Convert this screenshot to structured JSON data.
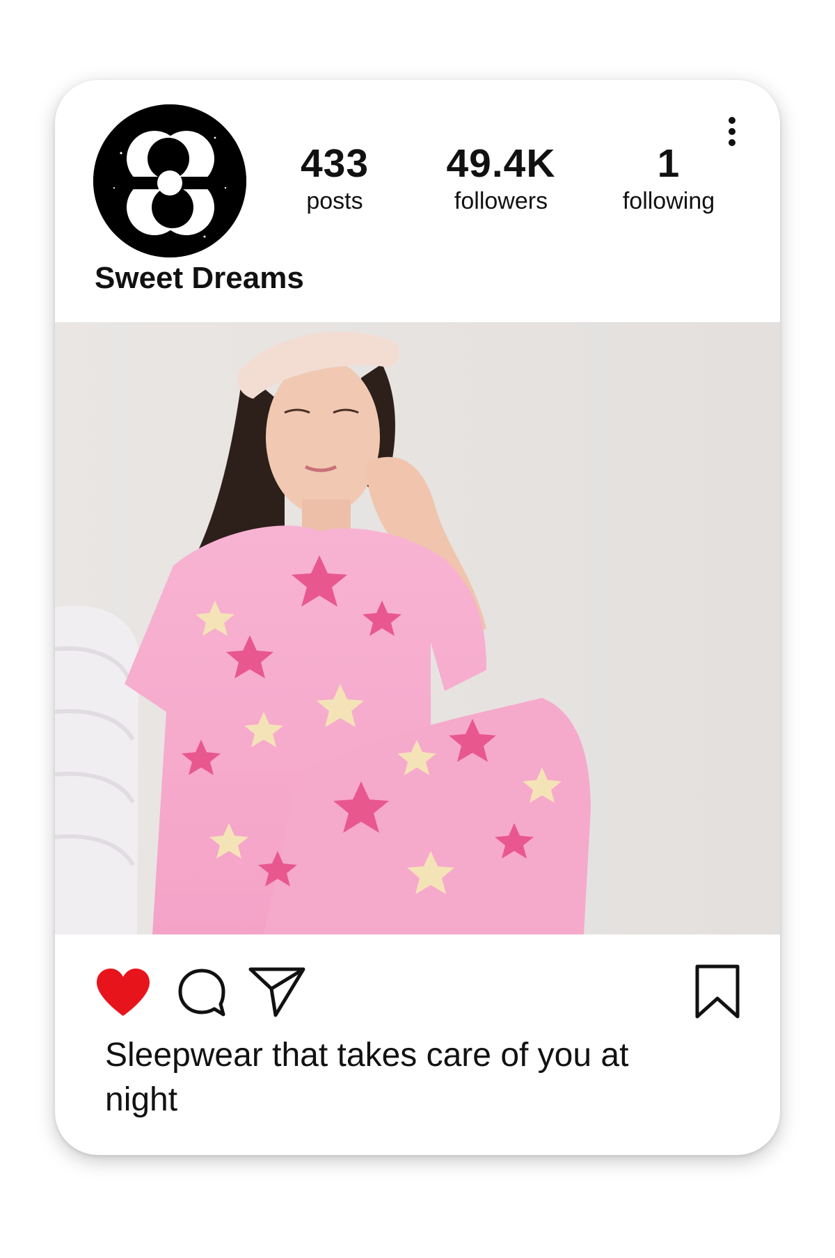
{
  "profile": {
    "name": "Sweet Dreams",
    "avatar_icon": "sweet-dreams-logo",
    "stats": [
      {
        "value": "433",
        "label": "posts"
      },
      {
        "value": "49.4K",
        "label": "followers"
      },
      {
        "value": "1",
        "label": "following"
      }
    ],
    "menu_icon": "more-vertical-icon"
  },
  "post": {
    "image_subject": "",
    "actions": {
      "like_icon": "heart-filled-icon",
      "comment_icon": "comment-bubble-icon",
      "share_icon": "paper-plane-icon",
      "save_icon": "bookmark-icon"
    },
    "caption": "Sleepwear that takes care of you at night"
  },
  "colors": {
    "like_red": "#e8141c",
    "pajama_pink": "#f7a8cc",
    "star_pink": "#e8588f",
    "star_cream": "#f5e3b8",
    "background_wall": "#e8e5e3"
  }
}
